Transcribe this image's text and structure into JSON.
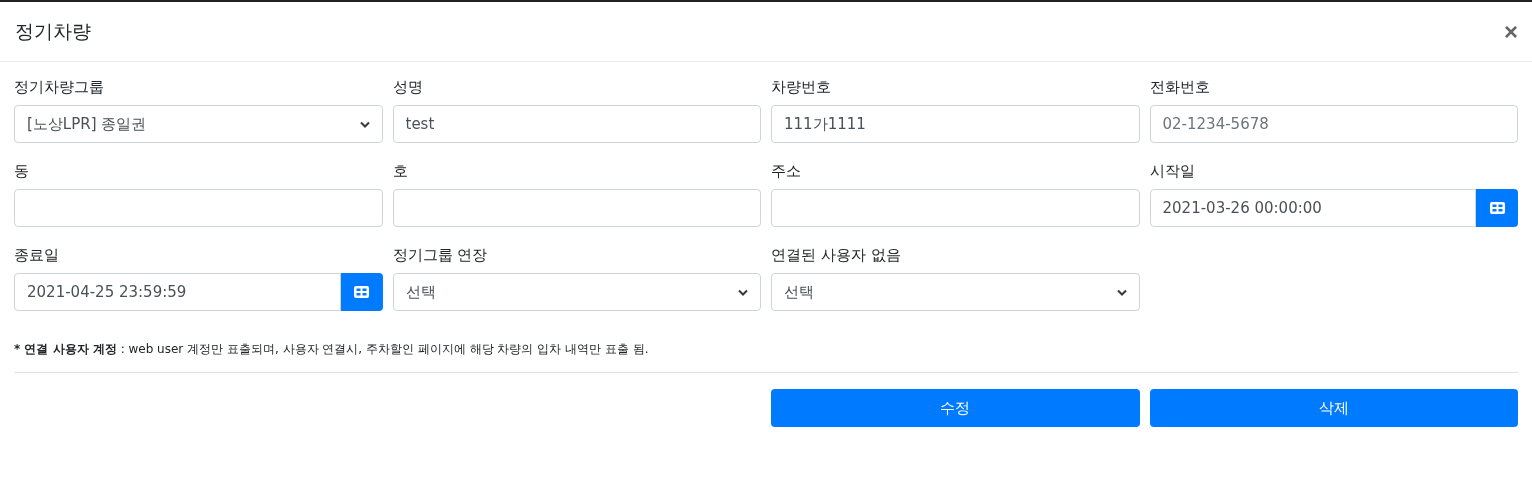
{
  "dialog": {
    "title": "정기차량",
    "close": "×"
  },
  "fields": [
    {
      "label": "정기차량그룹",
      "kind": "select",
      "value": "[노상LPR] 종일권"
    },
    {
      "label": "성명",
      "kind": "text",
      "value": "test"
    },
    {
      "label": "차량번호",
      "kind": "text",
      "value": "111가1111"
    },
    {
      "label": "전화번호",
      "kind": "text",
      "placeholder": "02-1234-5678"
    },
    {
      "label": "동",
      "kind": "text"
    },
    {
      "label": "호",
      "kind": "text"
    },
    {
      "label": "주소",
      "kind": "text"
    },
    {
      "label": "시작일",
      "kind": "date",
      "value": "2021-03-26 00:00:00"
    },
    {
      "label": "종료일",
      "kind": "date",
      "value": "2021-04-25 23:59:59"
    },
    {
      "label": "정기그룹 연장",
      "kind": "select",
      "value": "선택"
    },
    {
      "label": "연결된 사용자 없음",
      "kind": "select",
      "value": "선택"
    }
  ],
  "note": "*** 연결 사용자 계정** : web user 계정만 표출되며, 사용자 연결시, 주차할인 페이지에 해당 차량의 입차 내역만 표출 됨.",
  "buttons": [
    "수정",
    "삭제"
  ]
}
